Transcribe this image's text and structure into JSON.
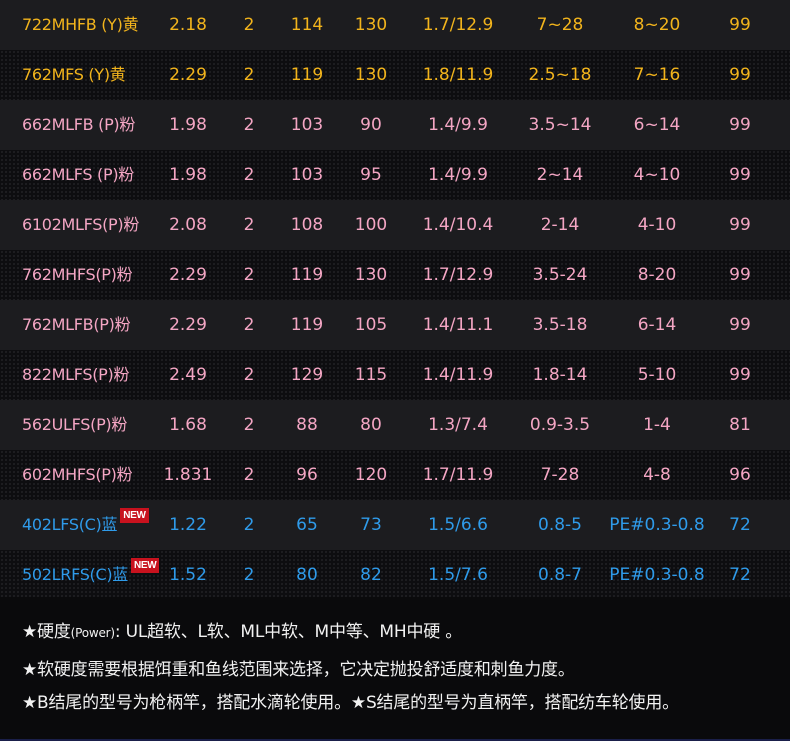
{
  "colors": {
    "yellow": "#f2b41c",
    "pink": "#f4a6c4",
    "blue": "#2f9bea",
    "badge": "#c8121e"
  },
  "rows": [
    {
      "model": "722MHFB (Y)黄",
      "color": "yellow",
      "new": false,
      "cols": [
        "2.18",
        "2",
        "114",
        "130",
        "1.7/12.9",
        "7~28",
        "8~20",
        "99"
      ]
    },
    {
      "model": "762MFS (Y)黄",
      "color": "yellow",
      "new": false,
      "cols": [
        "2.29",
        "2",
        "119",
        "130",
        "1.8/11.9",
        "2.5~18",
        "7~16",
        "99"
      ]
    },
    {
      "model": "662MLFB (P)粉",
      "color": "pink",
      "new": false,
      "cols": [
        "1.98",
        "2",
        "103",
        "90",
        "1.4/9.9",
        "3.5~14",
        "6~14",
        "99"
      ]
    },
    {
      "model": "662MLFS (P)粉",
      "color": "pink",
      "new": false,
      "cols": [
        "1.98",
        "2",
        "103",
        "95",
        "1.4/9.9",
        "2~14",
        "4~10",
        "99"
      ]
    },
    {
      "model": "6102MLFS(P)粉",
      "color": "pink",
      "new": false,
      "cols": [
        "2.08",
        "2",
        "108",
        "100",
        "1.4/10.4",
        "2-14",
        "4-10",
        "99"
      ]
    },
    {
      "model": "762MHFS(P)粉",
      "color": "pink",
      "new": false,
      "cols": [
        "2.29",
        "2",
        "119",
        "130",
        "1.7/12.9",
        "3.5-24",
        "8-20",
        "99"
      ]
    },
    {
      "model": "762MLFB(P)粉",
      "color": "pink",
      "new": false,
      "cols": [
        "2.29",
        "2",
        "119",
        "105",
        "1.4/11.1",
        "3.5-18",
        "6-14",
        "99"
      ]
    },
    {
      "model": "822MLFS(P)粉",
      "color": "pink",
      "new": false,
      "cols": [
        "2.49",
        "2",
        "129",
        "115",
        "1.4/11.9",
        "1.8-14",
        "5-10",
        "99"
      ]
    },
    {
      "model": "562ULFS(P)粉",
      "color": "pink",
      "new": false,
      "cols": [
        "1.68",
        "2",
        "88",
        "80",
        "1.3/7.4",
        "0.9-3.5",
        "1-4",
        "81"
      ]
    },
    {
      "model": "602MHFS(P)粉",
      "color": "pink",
      "new": false,
      "cols": [
        "1.831",
        "2",
        "96",
        "120",
        "1.7/11.9",
        "7-28",
        "4-8",
        "96"
      ]
    },
    {
      "model": "402LFS(C)蓝",
      "color": "blue",
      "new": true,
      "cols": [
        "1.22",
        "2",
        "65",
        "73",
        "1.5/6.6",
        "0.8-5",
        "PE#0.3-0.8",
        "72"
      ]
    },
    {
      "model": "502LRFS(C)蓝",
      "color": "blue",
      "new": true,
      "cols": [
        "1.52",
        "2",
        "80",
        "82",
        "1.5/7.6",
        "0.8-7",
        "PE#0.3-0.8",
        "72"
      ]
    }
  ],
  "badge_label": "NEW",
  "notes": {
    "line1_prefix": "★硬度",
    "line1_small": "(Power)",
    "line1_rest": ": UL超软、L软、ML中软、M中等、MH中硬 。",
    "line2": "★软硬度需要根据饵重和鱼线范围来选择，它决定抛投舒适度和刺鱼力度。",
    "line3": "★B结尾的型号为枪柄竿，搭配水滴轮使用。★S结尾的型号为直柄竿，搭配纺车轮使用。"
  }
}
